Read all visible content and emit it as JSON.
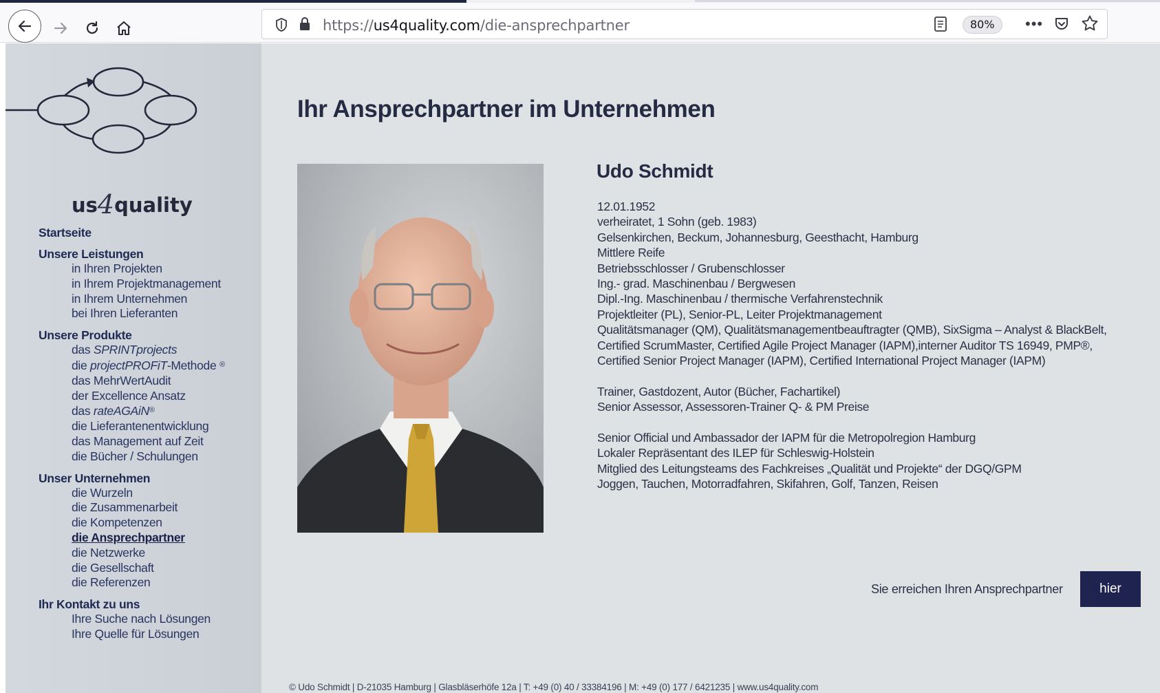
{
  "browser": {
    "url_scheme": "https://",
    "url_host": "us4quality.com",
    "url_path": "/die-ansprechpartner",
    "zoom": "80%",
    "more": "•••"
  },
  "logo": {
    "text_pre": "us",
    "text_num": "4",
    "text_post": "quality"
  },
  "sidebar": {
    "home": "Startseite",
    "sections": {
      "leistungen": {
        "heading": "Unsere Leistungen",
        "items": [
          "in Ihren Projekten",
          "in Ihrem Projektmanagement",
          "in Ihrem Unternehmen",
          "bei Ihren Lieferanten"
        ]
      },
      "produkte": {
        "heading": "Unsere Produkte",
        "items": [
          {
            "pre": "das ",
            "em": "SPRINTprojects",
            "post": ""
          },
          {
            "pre": "die ",
            "em": "projectPROFiT",
            "post": "-Methode",
            "mark": "®"
          },
          {
            "pre": "das MehrWertAudit",
            "em": "",
            "post": ""
          },
          {
            "pre": "der Excellence Ansatz",
            "em": "",
            "post": ""
          },
          {
            "pre": "das ",
            "em": "rateAGAiN",
            "post": "",
            "mark": "®"
          },
          {
            "pre": "die Lieferantenentwicklung",
            "em": "",
            "post": ""
          },
          {
            "pre": "das Management auf Zeit",
            "em": "",
            "post": ""
          },
          {
            "pre": "die Bücher / Schulungen",
            "em": "",
            "post": ""
          }
        ]
      },
      "unternehmen": {
        "heading": "Unser Unternehmen",
        "items": [
          "die Wurzeln",
          "die Zusammenarbeit",
          "die Kompetenzen",
          "die Ansprechpartner",
          "die Netzwerke",
          "die Gesellschaft",
          "die Referenzen"
        ]
      },
      "kontakt": {
        "heading": "Ihr Kontakt zu uns",
        "items": [
          "Ihre Suche nach Lösungen",
          "Ihre Quelle für Lösungen"
        ]
      }
    }
  },
  "main": {
    "title": "Ihr Ansprechpartner im Unternehmen",
    "name": "Udo Schmidt",
    "bio_block1": [
      "12.01.1952",
      "verheiratet, 1 Sohn (geb. 1983)",
      "Gelsenkirchen, Beckum, Johannesburg, Geesthacht, Hamburg",
      "Mittlere Reife",
      "Betriebsschlosser / Grubenschlosser",
      "Ing.- grad. Maschinenbau / Bergwesen",
      "Dipl.-Ing. Maschinenbau / thermische Verfahrenstechnik",
      "Projektleiter (PL), Senior-PL, Leiter Projektmanagement",
      "Qualitätsmanager (QM), Qualitätsmanagementbeauftragter (QMB), SixSigma – Analyst & BlackBelt,",
      "Certified ScrumMaster, Certified Agile Project Manager (IAPM),interner Auditor TS 16949, PMP®,",
      "Certified Senior Project Manager (IAPM), Certified International Project Manager (IAPM)"
    ],
    "bio_block2": [
      "Trainer, Gastdozent, Autor (Bücher, Fachartikel)",
      "Senior Assessor, Assessoren-Trainer Q- & PM Preise"
    ],
    "bio_block3": [
      "Senior Official und Ambassador der IAPM für die Metropolregion Hamburg",
      "Lokaler Repräsentant des ILEP für Schleswig-Holstein",
      "Mitglied des Leitungsteams des Fachkreises „Qualität und Projekte“ der DGQ/GPM",
      "Joggen, Tauchen, Motorradfahren, Skifahren, Golf, Tanzen, Reisen"
    ],
    "contact_text": "Sie erreichen Ihren Ansprechpartner",
    "contact_button": "hier"
  },
  "footer": "© Udo Schmidt  | D-21035 Hamburg | Glasbläserhöfe 12a  |  T: +49 (0) 40 / 33384196  |  M: +49 (0) 177 / 6421235  |  www.us4quality.com",
  "colors": {
    "sidebar_bg": "#cfd5db",
    "main_bg": "#dfe2e5",
    "nav_text": "#1f2a53",
    "button_bg": "#1e2350"
  }
}
